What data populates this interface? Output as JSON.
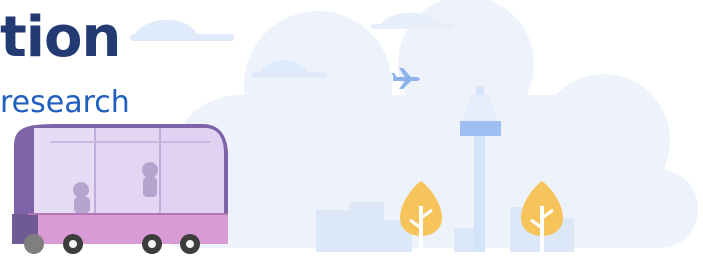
{
  "banner": {
    "headline_fragment": "tion",
    "subline_fragment": "research"
  },
  "colors": {
    "headline": "#243a73",
    "subline": "#1f5fbf",
    "cloud": "#eef3fb",
    "tower": "#d9e7fa",
    "tree": "#f7c45c",
    "shuttle_body": "#d89bd6",
    "shuttle_top": "#7d63a7"
  },
  "icons": [
    "cloud-icon",
    "airplane-icon",
    "control-tower-icon",
    "tree-icon",
    "shuttle-icon"
  ]
}
